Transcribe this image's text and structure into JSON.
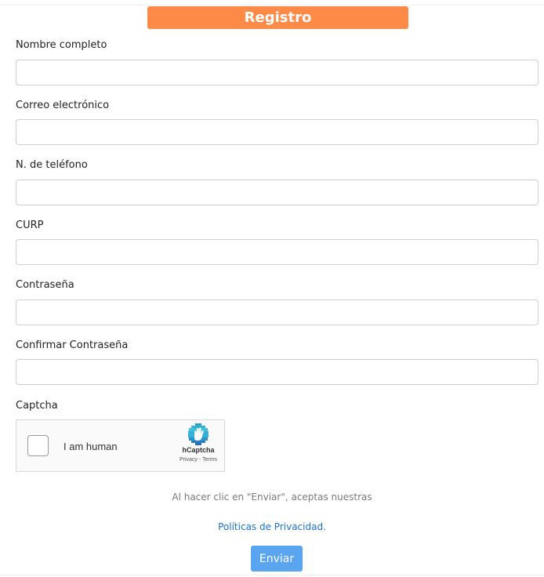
{
  "header": {
    "title": "Registro",
    "color": "#fd8a47"
  },
  "form": {
    "fields": [
      {
        "label": "Nombre completo",
        "value": "",
        "type": "text"
      },
      {
        "label": "Correo electrónico",
        "value": "",
        "type": "email"
      },
      {
        "label": "N. de teléfono",
        "value": "",
        "type": "tel"
      },
      {
        "label": "CURP",
        "value": "",
        "type": "text"
      },
      {
        "label": "Contraseña",
        "value": "",
        "type": "password"
      },
      {
        "label": "Confirmar Contraseña",
        "value": "",
        "type": "password"
      }
    ],
    "captcha_label": "Captcha"
  },
  "captcha": {
    "checkbox_label": "I am human",
    "brand": "hCaptcha",
    "privacy": "Privacy",
    "separator": " - ",
    "terms": "Terms",
    "icon": "hcaptcha-hand-icon",
    "logo_color": "#38b2d4"
  },
  "footer": {
    "notice": "Al hacer clic en \"Enviar\", aceptas nuestras",
    "policy_link": "Políticas de Privacidad.",
    "link_color": "#1a73c8",
    "submit_label": "Enviar",
    "submit_color": "#5aa5f0"
  }
}
